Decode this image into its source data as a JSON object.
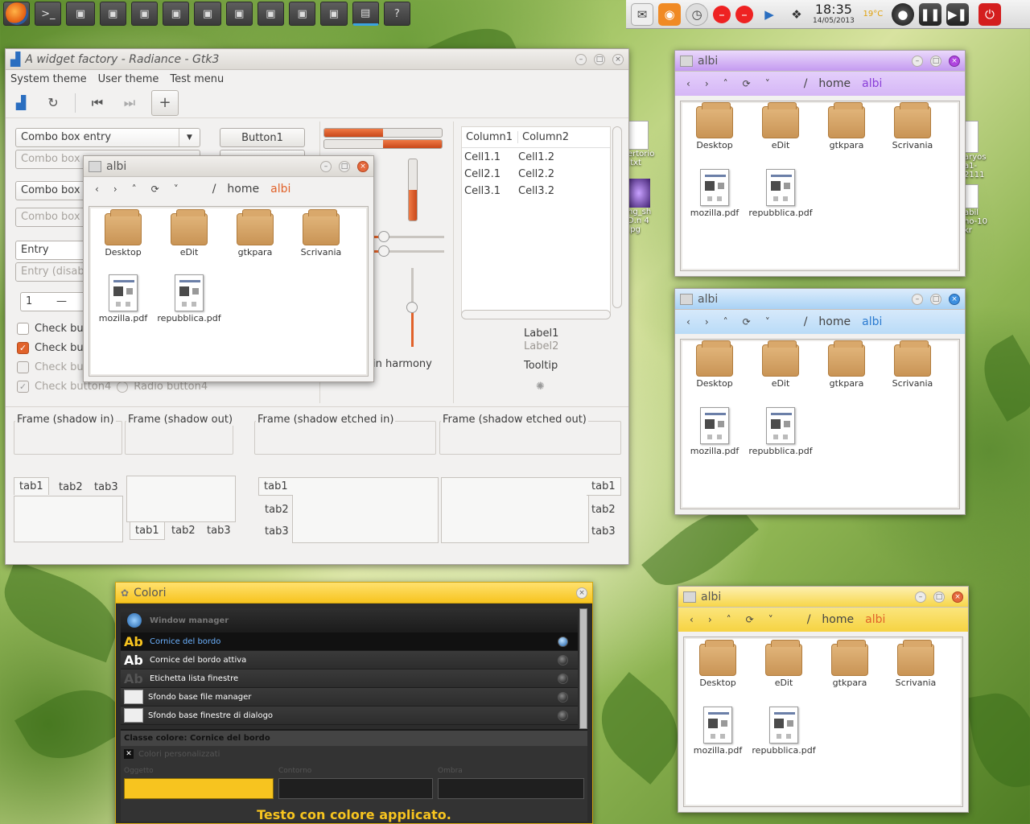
{
  "taskbar": {
    "buttons": [
      "firefox-icon",
      "terminal-icon",
      "window-icon",
      "window-icon",
      "window-icon",
      "window-icon",
      "window-icon",
      "window-icon",
      "window-icon",
      "window-icon",
      "window-icon",
      "window-icon",
      "window-icon"
    ]
  },
  "tray": {
    "time": "18:35",
    "date": "14/05/2013",
    "temperature": "19°C"
  },
  "desktop": {
    "icons": [
      {
        "label": "ertorio\n.txt"
      },
      {
        "label": "ng_sh\nD.n 4\n.pg"
      },
      {
        "label": "aryos\na1-\n2111"
      },
      {
        "label": "abil\nno-10\nkr"
      }
    ]
  },
  "widget_factory": {
    "title": "A widget factory - Radiance - Gtk3",
    "menu": [
      "System theme",
      "User theme",
      "Test menu"
    ],
    "combo1": "Combo box entry",
    "combo2": "Combo box",
    "combo3": "Combo box",
    "combo4": "Combo box",
    "entry": "Entry",
    "entry_disabled": "Entry (disab",
    "spin_value": "1",
    "spin_minus": "—",
    "button1": "Button1",
    "checks": [
      "Check but",
      "Check but",
      "Check but",
      "Check button4"
    ],
    "radio4": "Radio button4",
    "harmony": "in harmony",
    "columns": [
      "Column1",
      "Column2"
    ],
    "rows": [
      [
        "Cell1.1",
        "Cell1.2"
      ],
      [
        "Cell2.1",
        "Cell2.2"
      ],
      [
        "Cell3.1",
        "Cell3.2"
      ]
    ],
    "label1": "Label1",
    "label2": "Label2",
    "tooltip": "Tooltip",
    "frames": [
      "Frame (shadow in)",
      "Frame (shadow out)",
      "Frame (shadow etched in)",
      "Frame (shadow etched out)"
    ],
    "tabs": [
      "tab1",
      "tab2",
      "tab3"
    ],
    "progress": [
      0.45,
      0.45
    ]
  },
  "fm_small": {
    "title": "albi",
    "crumb_home": "home",
    "crumb_user": "albi",
    "items": [
      "Desktop",
      "eDit",
      "gtkpara",
      "Scrivania",
      "mozilla.pdf",
      "repubblica.pdf"
    ]
  },
  "fm_purple": {
    "title": "albi",
    "crumb_home": "home",
    "crumb_user": "albi",
    "accent": "#c49af0",
    "items": [
      "Desktop",
      "eDit",
      "gtkpara",
      "Scrivania",
      "mozilla.pdf",
      "repubblica.pdf"
    ]
  },
  "fm_blue": {
    "title": "albi",
    "crumb_home": "home",
    "crumb_user": "albi",
    "accent": "#a9d2f5",
    "items": [
      "Desktop",
      "eDit",
      "gtkpara",
      "Scrivania",
      "mozilla.pdf",
      "repubblica.pdf"
    ]
  },
  "fm_yellow": {
    "title": "albi",
    "crumb_home": "home",
    "crumb_user": "albi",
    "accent": "#f7d64a",
    "items": [
      "Desktop",
      "eDit",
      "gtkpara",
      "Scrivania",
      "mozilla.pdf",
      "repubblica.pdf"
    ]
  },
  "colori": {
    "title": "Colori",
    "header": "Window manager",
    "rows": [
      {
        "label": "Cornice del bordo",
        "kind": "Ab"
      },
      {
        "label": "Cornice del bordo attiva",
        "kind": "Ab"
      },
      {
        "label": "Etichetta lista finestre",
        "kind": "Ab"
      },
      {
        "label": "Sfondo base file manager",
        "kind": "swatch"
      },
      {
        "label": "Sfondo base finestre di dialogo",
        "kind": "swatch"
      }
    ],
    "class_label": "Classe colore: Cornice del bordo",
    "custom": "Colori personalizzati",
    "fields": [
      "Oggetto",
      "Contorno",
      "Ombra"
    ],
    "applied": "Testo con colore applicato.",
    "selected_color": "#f7c41f"
  }
}
